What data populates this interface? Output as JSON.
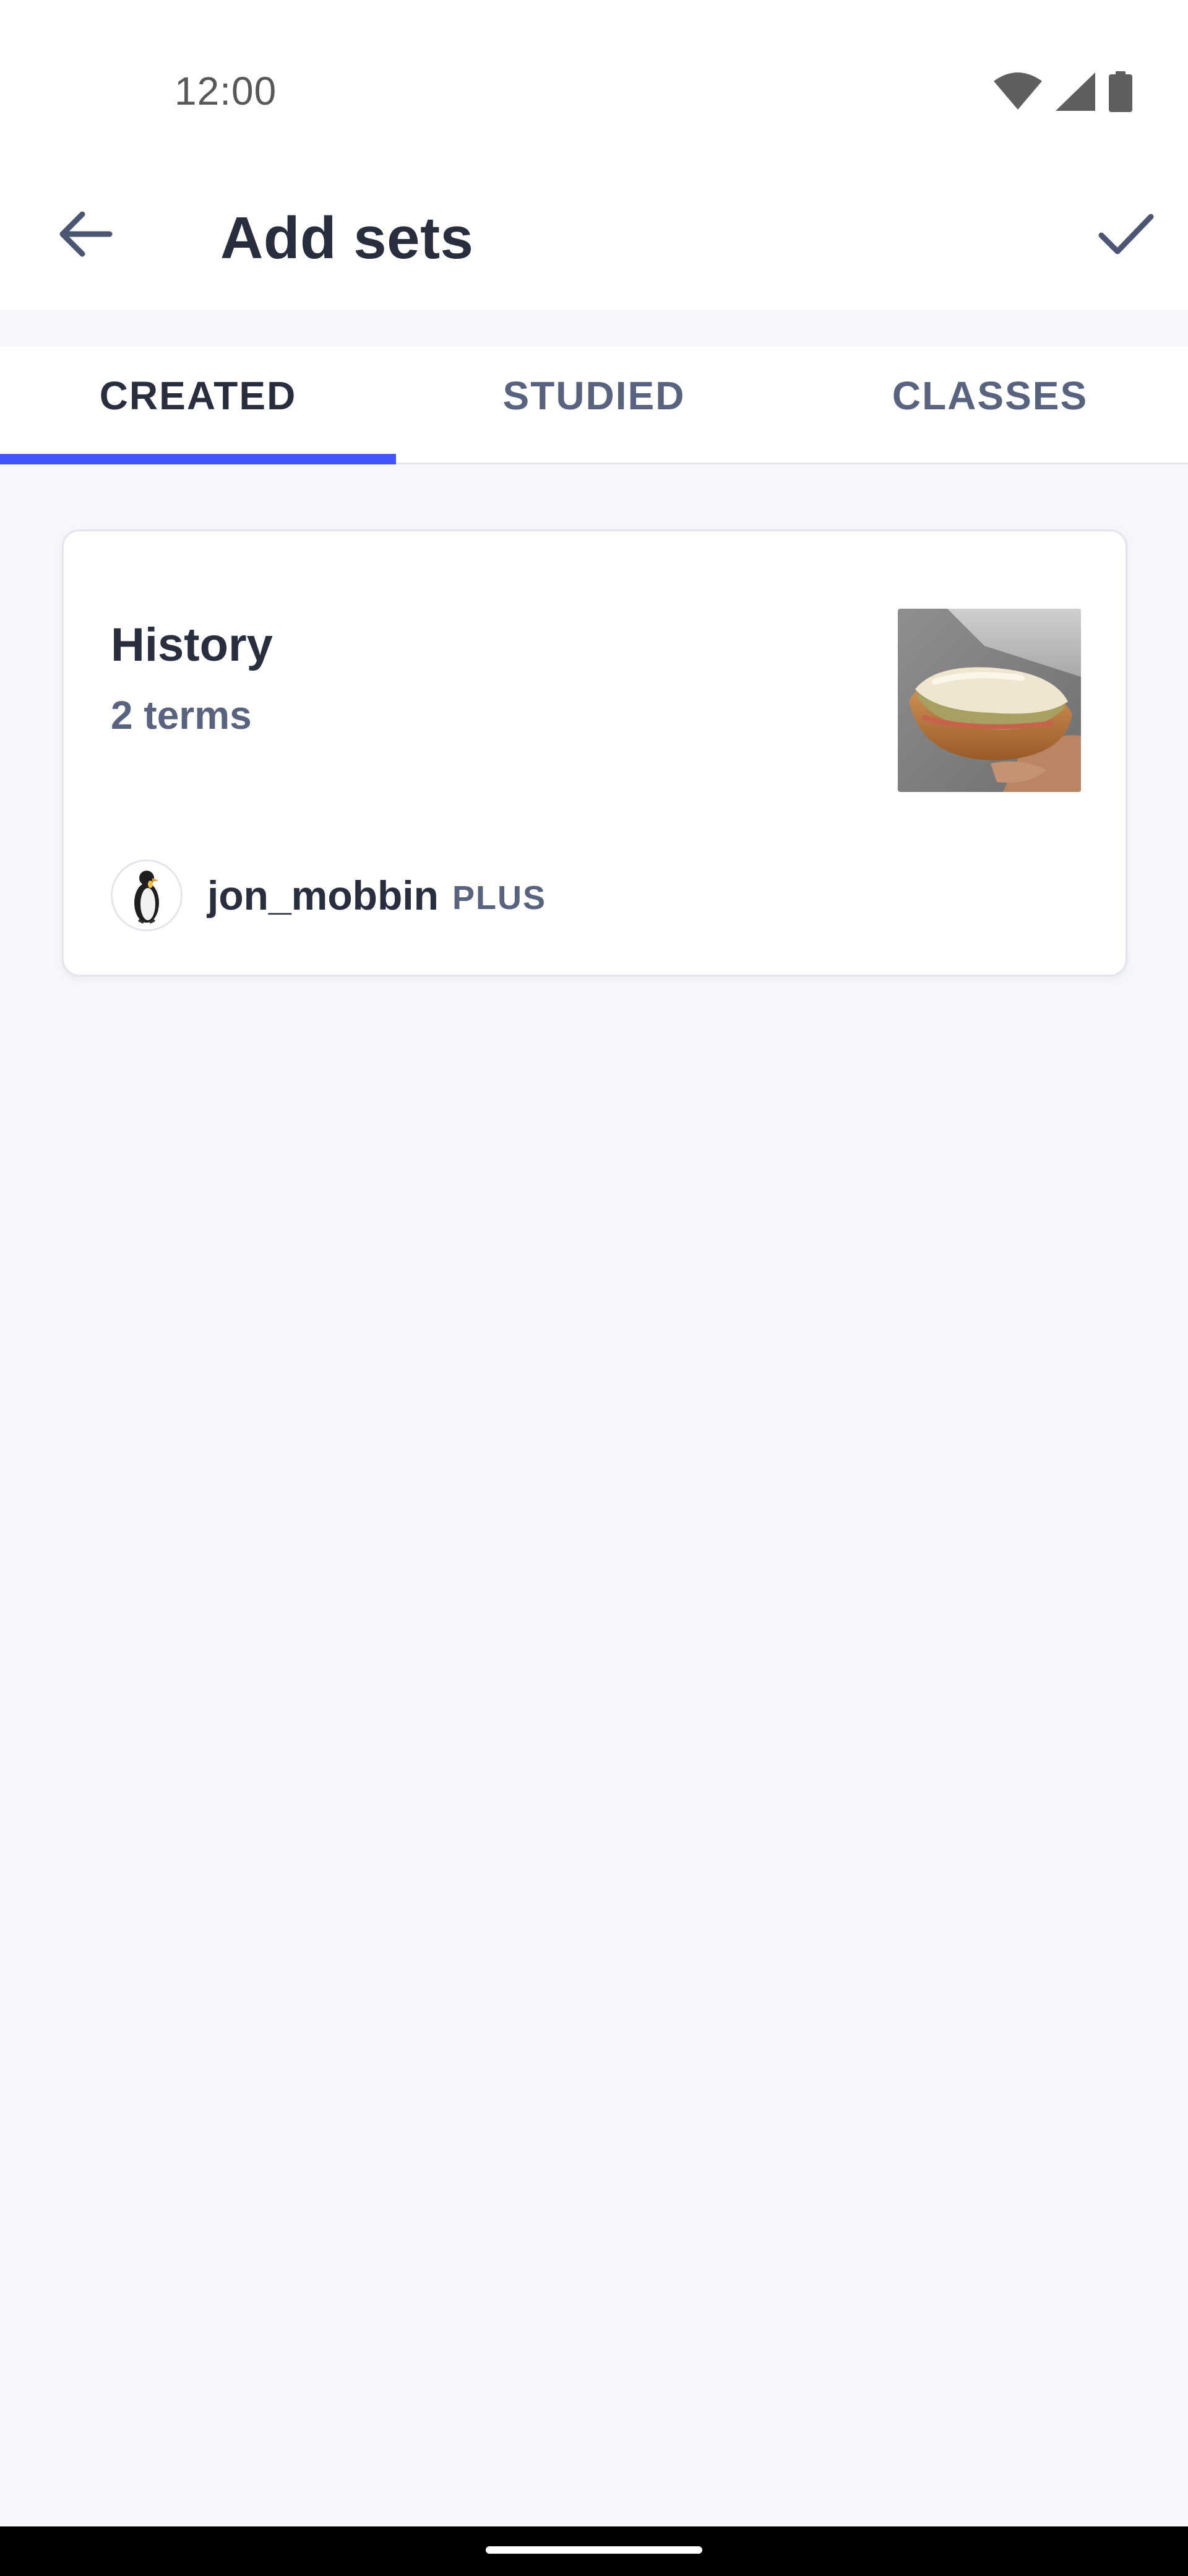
{
  "status_bar": {
    "time": "12:00",
    "icons": [
      "wifi-icon",
      "cellular-signal-icon",
      "battery-icon"
    ]
  },
  "app_bar": {
    "title": "Add sets",
    "back_icon": "arrow-left-icon",
    "done_icon": "check-icon"
  },
  "tabs": [
    {
      "label": "CREATED",
      "active": true
    },
    {
      "label": "STUDIED",
      "active": false
    },
    {
      "label": "CLASSES",
      "active": false
    }
  ],
  "set_card": {
    "title": "History",
    "term_count": "2 terms",
    "thumbnail": "hot-dog-image",
    "author": {
      "username": "jon_mobbin",
      "badge": "PLUS",
      "avatar": "penguin-avatar"
    }
  },
  "colors": {
    "accent": "#4255ff",
    "text_primary": "#282e3e",
    "text_secondary": "#586380",
    "background": "#f6f7fb",
    "surface": "#ffffff"
  }
}
